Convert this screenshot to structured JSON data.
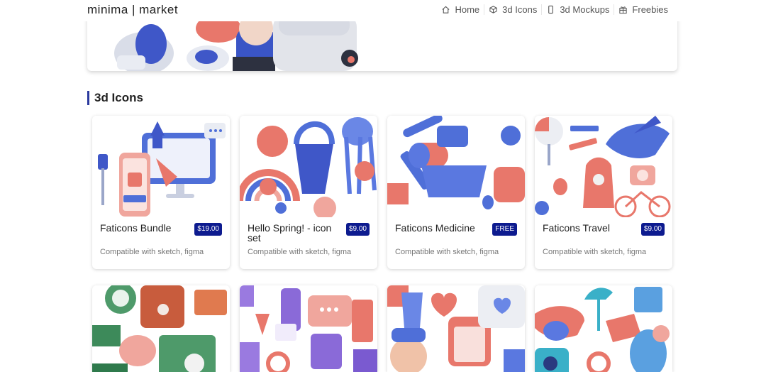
{
  "header": {
    "logo": "minima | market",
    "nav": [
      {
        "label": "Home",
        "icon": "home-icon"
      },
      {
        "label": "3d Icons",
        "icon": "cube-icon"
      },
      {
        "label": "3d Mockups",
        "icon": "phone-icon"
      },
      {
        "label": "Freebies",
        "icon": "gift-icon"
      }
    ]
  },
  "section": {
    "title": "3d Icons"
  },
  "products": [
    {
      "title": "Faticons Bundle",
      "price": "$19.00",
      "subtitle": "Compatible with sketch, figma"
    },
    {
      "title": "Hello Spring! - icon set",
      "price": "$9.00",
      "subtitle": "Compatible with sketch, figma"
    },
    {
      "title": "Faticons Medicine",
      "price": "FREE",
      "subtitle": "Compatible with sketch, figma"
    },
    {
      "title": "Faticons Travel",
      "price": "$9.00",
      "subtitle": "Compatible with sketch, figma"
    }
  ],
  "colors": {
    "accent": "#0d1b8f",
    "section_bar": "#2b3a9e",
    "coral": "#e8776b",
    "blue": "#4f6fd8"
  }
}
